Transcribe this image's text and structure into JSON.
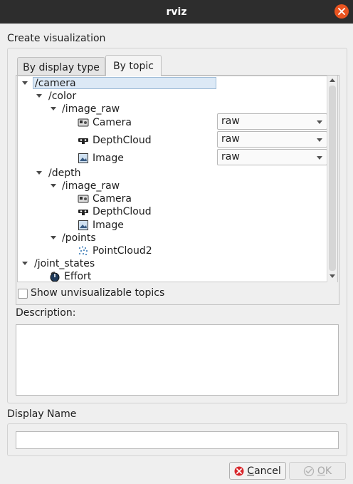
{
  "window": {
    "title": "rviz"
  },
  "dialog": {
    "group_title": "Create visualization",
    "tabs": [
      {
        "label": "By display type",
        "active": false
      },
      {
        "label": "By topic",
        "active": true
      }
    ],
    "tree": {
      "camera": "/camera",
      "color": "/color",
      "color_image_raw": "/image_raw",
      "color_camera": "Camera",
      "color_depthcloud": "DepthCloud",
      "color_image": "Image",
      "depth": "/depth",
      "depth_image_raw": "/image_raw",
      "depth_camera": "Camera",
      "depth_depthcloud": "DepthCloud",
      "depth_image": "Image",
      "points": "/points",
      "pointcloud2": "PointCloud2",
      "joint_states": "/joint_states",
      "effort": "Effort"
    },
    "combos": {
      "camera": "raw",
      "depthcloud": "raw",
      "image": "raw"
    },
    "show_unvisualizable": {
      "label": "Show unvisualizable topics",
      "checked": false
    },
    "description": {
      "label": "Description:",
      "value": ""
    },
    "display_name": {
      "label": "Display Name",
      "value": ""
    },
    "buttons": {
      "cancel": {
        "label_pre": "",
        "label_underlined": "C",
        "label_post": "ancel"
      },
      "ok": {
        "label_pre": "",
        "label_underlined": "O",
        "label_post": "K",
        "enabled": false
      }
    }
  },
  "colors": {
    "titlebar": "#2d2d2d",
    "close": "#e95420",
    "selection": "#dce9f6"
  }
}
